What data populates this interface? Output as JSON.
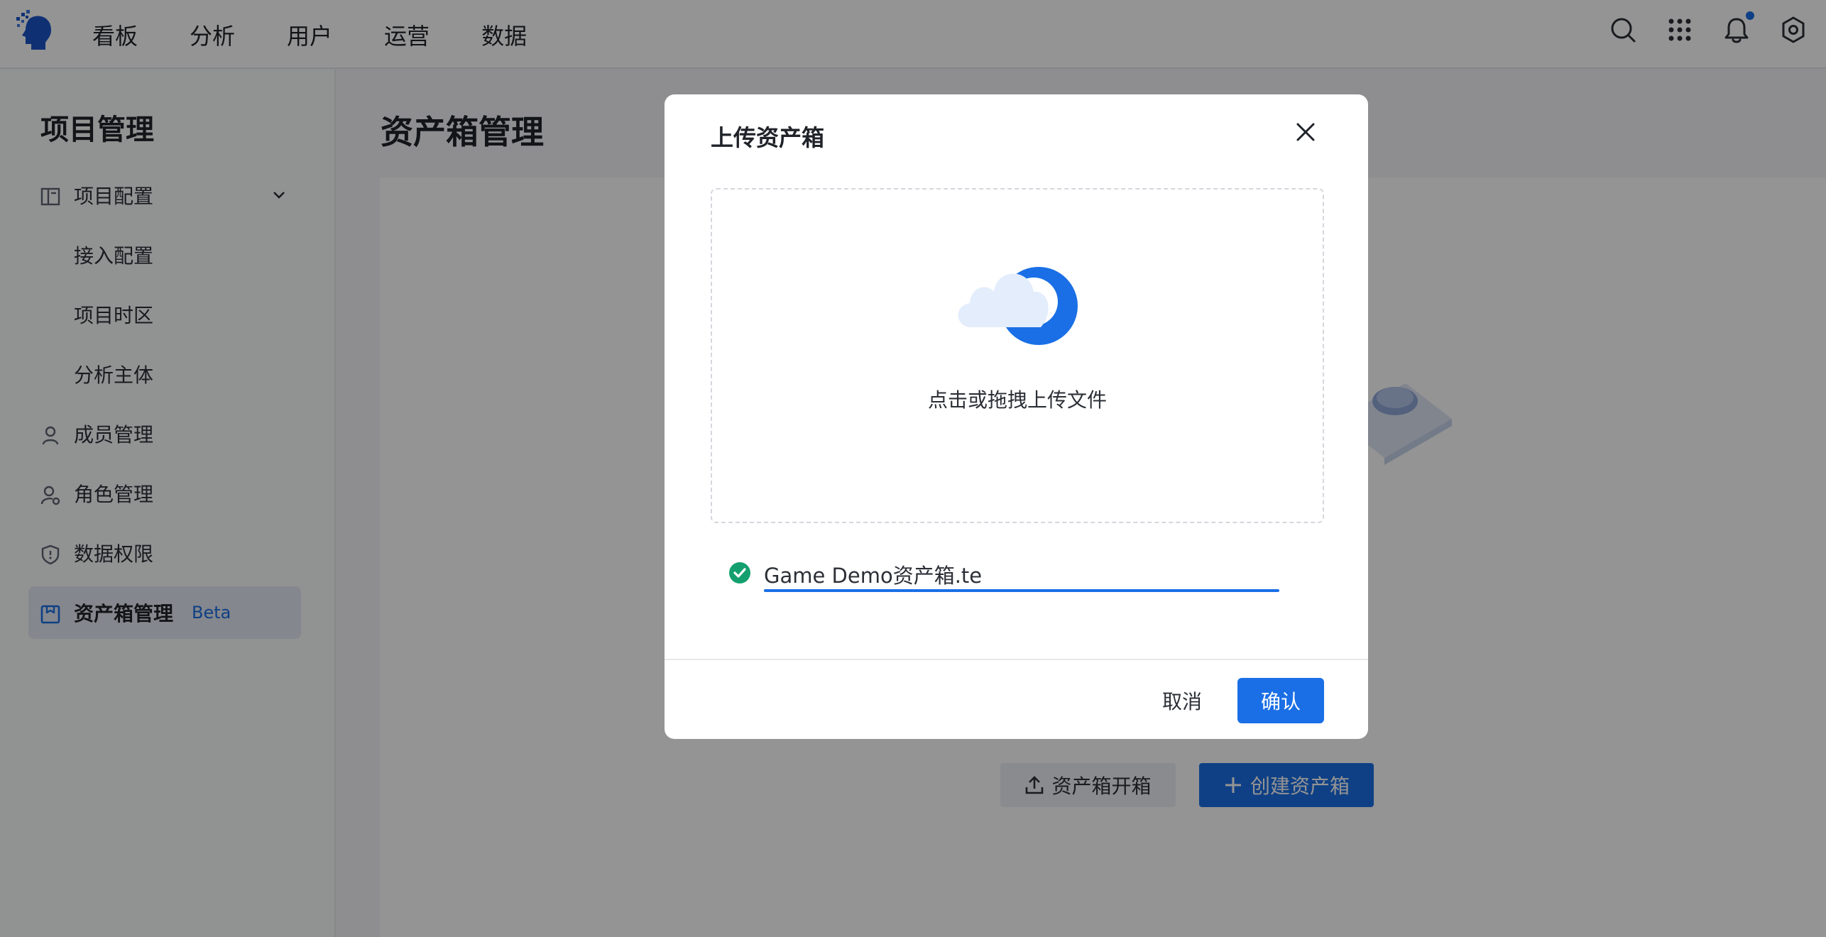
{
  "colors": {
    "accent": "#1a6fe6",
    "success": "#14a06e",
    "overlay": "rgba(0,0,0,0.42)"
  },
  "topnav": {
    "tabs": [
      "看板",
      "分析",
      "用户",
      "运营",
      "数据"
    ],
    "icons": [
      "search-icon",
      "apps-grid-icon",
      "bell-icon",
      "settings-icon"
    ],
    "has_notification": true
  },
  "sidebar": {
    "title": "项目管理",
    "items": [
      {
        "label": "项目配置",
        "icon": "layout-icon",
        "expanded": true
      },
      {
        "label": "接入配置"
      },
      {
        "label": "项目时区"
      },
      {
        "label": "分析主体"
      },
      {
        "label": "成员管理",
        "icon": "user-icon"
      },
      {
        "label": "角色管理",
        "icon": "user-gear-icon"
      },
      {
        "label": "数据权限",
        "icon": "shield-icon"
      },
      {
        "label": "资产箱管理",
        "icon": "box-icon",
        "badge": "Beta",
        "active": true
      }
    ]
  },
  "main": {
    "title": "资产箱管理",
    "open_button": "资产箱开箱",
    "create_button": "创建资产箱"
  },
  "modal": {
    "title": "上传资产箱",
    "dropzone_text": "点击或拖拽上传文件",
    "file": {
      "name": "Game Demo资产箱.te",
      "status": "success",
      "progress": 1.0
    },
    "cancel_label": "取消",
    "confirm_label": "确认"
  }
}
